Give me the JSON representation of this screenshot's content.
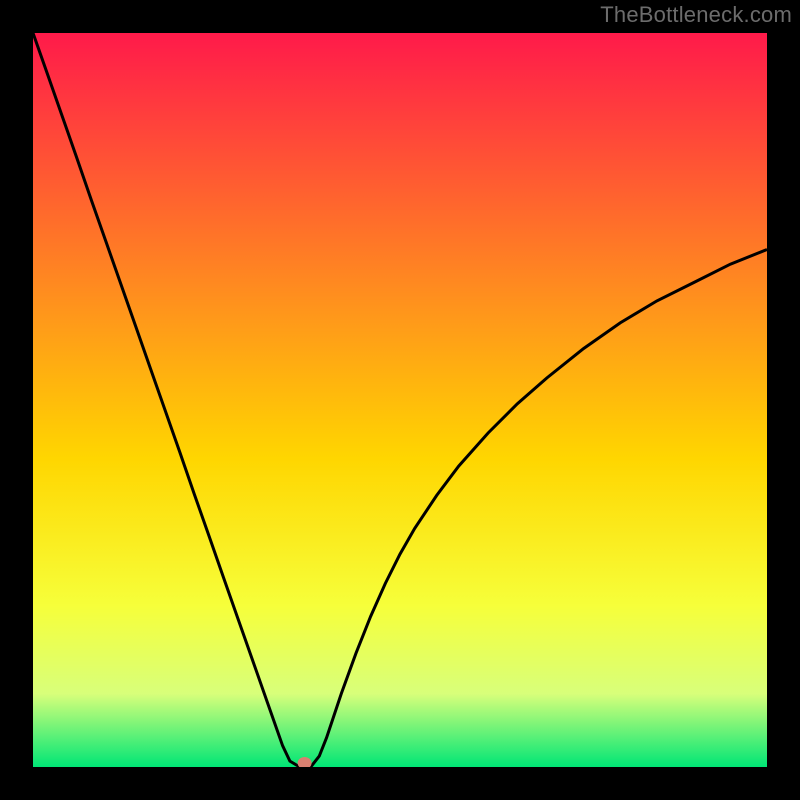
{
  "attribution": "TheBottleneck.com",
  "chart_data": {
    "type": "line",
    "title": "",
    "xlabel": "",
    "ylabel": "",
    "xlim": [
      0,
      100
    ],
    "ylim": [
      0,
      100
    ],
    "x": [
      0,
      2,
      4,
      6,
      8,
      10,
      12,
      14,
      16,
      18,
      20,
      22,
      24,
      26,
      28,
      30,
      32,
      34,
      35,
      36,
      37,
      38,
      39,
      40,
      42,
      44,
      46,
      48,
      50,
      52,
      55,
      58,
      62,
      66,
      70,
      75,
      80,
      85,
      90,
      95,
      100
    ],
    "values": [
      100,
      94.3,
      88.6,
      82.9,
      77.1,
      71.4,
      65.7,
      60.0,
      54.3,
      48.6,
      42.9,
      37.1,
      31.4,
      25.7,
      20.0,
      14.3,
      8.6,
      2.9,
      0.8,
      0.2,
      0,
      0.2,
      1.5,
      4.0,
      10.0,
      15.5,
      20.5,
      25.0,
      29.0,
      32.5,
      37.0,
      41.0,
      45.5,
      49.5,
      53.0,
      57.0,
      60.5,
      63.5,
      66.0,
      68.5,
      70.5
    ],
    "marker": {
      "x": 37,
      "y": 0
    },
    "annotations": [],
    "background_gradient": {
      "top": "#ff1a4a",
      "mid_upper": "#ff8c1f",
      "mid": "#ffd600",
      "mid_lower": "#f6ff3a",
      "lower": "#d8ff7a",
      "bottom": "#00e676"
    }
  },
  "marker_color": "#d88070"
}
